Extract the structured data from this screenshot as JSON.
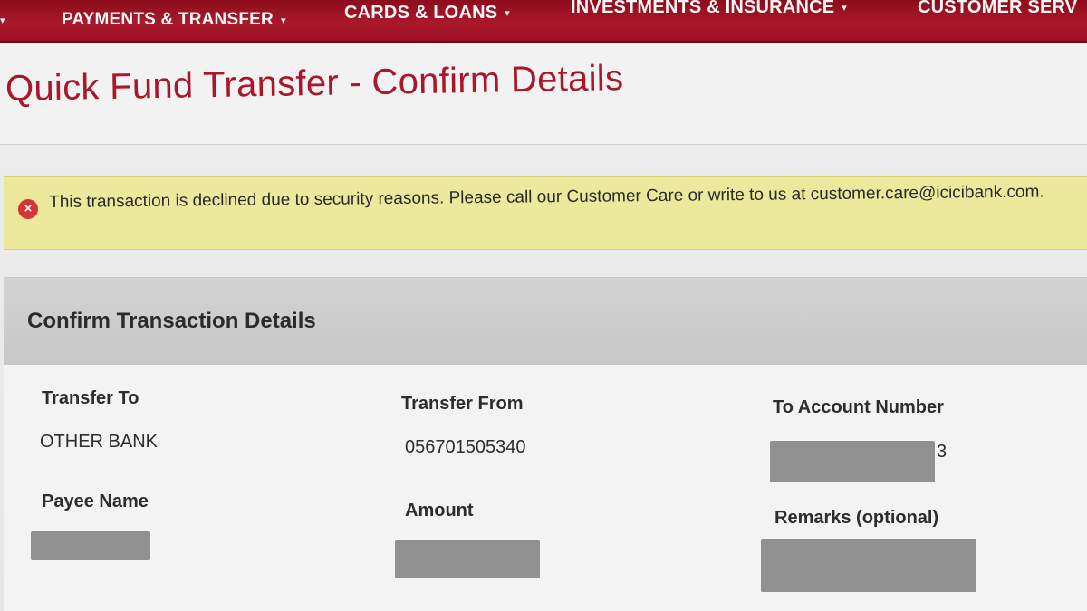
{
  "nav": {
    "first_caret": "▾",
    "items": [
      {
        "label": "PAYMENTS & TRANSFER",
        "caret": "▾"
      },
      {
        "label": "CARDS & LOANS",
        "caret": "▾"
      },
      {
        "label": "INVESTMENTS & INSURANCE",
        "caret": "▾"
      },
      {
        "label": "CUSTOMER SERV"
      }
    ]
  },
  "page": {
    "title": "Quick Fund Transfer - Confirm Details"
  },
  "alert": {
    "icon": "error-circle-icon",
    "icon_glyph": "×",
    "message": "This transaction is declined due to security reasons. Please call our Customer Care or write to us at customer.care@icicibank.com.",
    "color_bg": "#ece89c",
    "color_icon": "#d43535"
  },
  "details": {
    "title": "Confirm Transaction Details",
    "fields": {
      "transfer_to": {
        "label": "Transfer To",
        "value": "OTHER BANK"
      },
      "transfer_from": {
        "label": "Transfer From",
        "value": "056701505340"
      },
      "to_account": {
        "label": "To Account Number",
        "visible_suffix": "3"
      },
      "payee_name": {
        "label": "Payee Name"
      },
      "amount": {
        "label": "Amount"
      },
      "remarks": {
        "label": "Remarks (optional)"
      }
    }
  },
  "colors": {
    "brand_red": "#a8172b",
    "nav_bg": "#9c1224"
  }
}
